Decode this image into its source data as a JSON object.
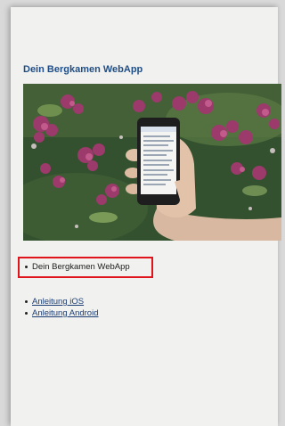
{
  "page": {
    "title": "Dein Bergkamen WebApp",
    "hero_image": "phone-in-hand-with-flowers",
    "highlighted_item": "Dein Bergkamen WebApp",
    "links": [
      "Anleitung iOS",
      "Anleitung Android"
    ]
  },
  "colors": {
    "title": "#1f4e86",
    "highlight_border": "#e0151c",
    "link": "#1c3d73"
  }
}
